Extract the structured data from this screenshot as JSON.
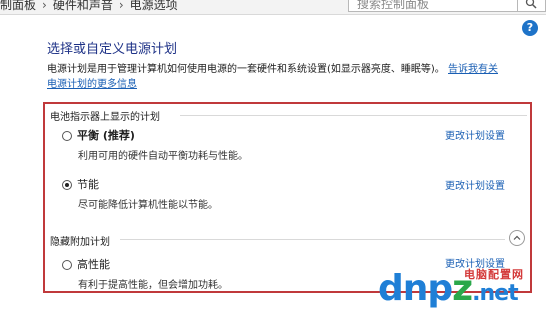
{
  "breadcrumb": {
    "items": [
      "制面板",
      "硬件和声音",
      "电源选项"
    ],
    "separator": "›"
  },
  "search": {
    "placeholder": "搜索控制面板"
  },
  "help": {
    "label": "?"
  },
  "page": {
    "title": "选择或自定义电源计划",
    "desc_text": "电源计划是用于管理计算机如何使用电源的一套硬件和系统设置(如显示器亮度、睡眠等)。",
    "desc_link1": "告诉我有关",
    "desc_link2": "电源计划的更多信息"
  },
  "battery_section": {
    "title": "电池指示器上显示的计划",
    "plans": [
      {
        "name": "平衡 (推荐)",
        "desc": "利用可用的硬件自动平衡功耗与性能。",
        "link": "更改计划设置",
        "checked": false
      },
      {
        "name": "节能",
        "desc": "尽可能降低计算机性能以节能。",
        "link": "更改计划设置",
        "checked": true
      }
    ]
  },
  "hidden_section": {
    "title": "隐藏附加计划",
    "plans": [
      {
        "name": "高性能",
        "desc": "有利于提高性能，但会增加功耗。",
        "link": "更改计划设置",
        "checked": false
      }
    ]
  },
  "watermark": {
    "site": "电脑配置网",
    "logo_main": "dnp",
    "logo_z": "z",
    "logo_tld": ".net"
  },
  "colors": {
    "accent_link": "#1a5fb4",
    "title_blue": "#1e3287",
    "highlight_frame": "#c0393b"
  }
}
